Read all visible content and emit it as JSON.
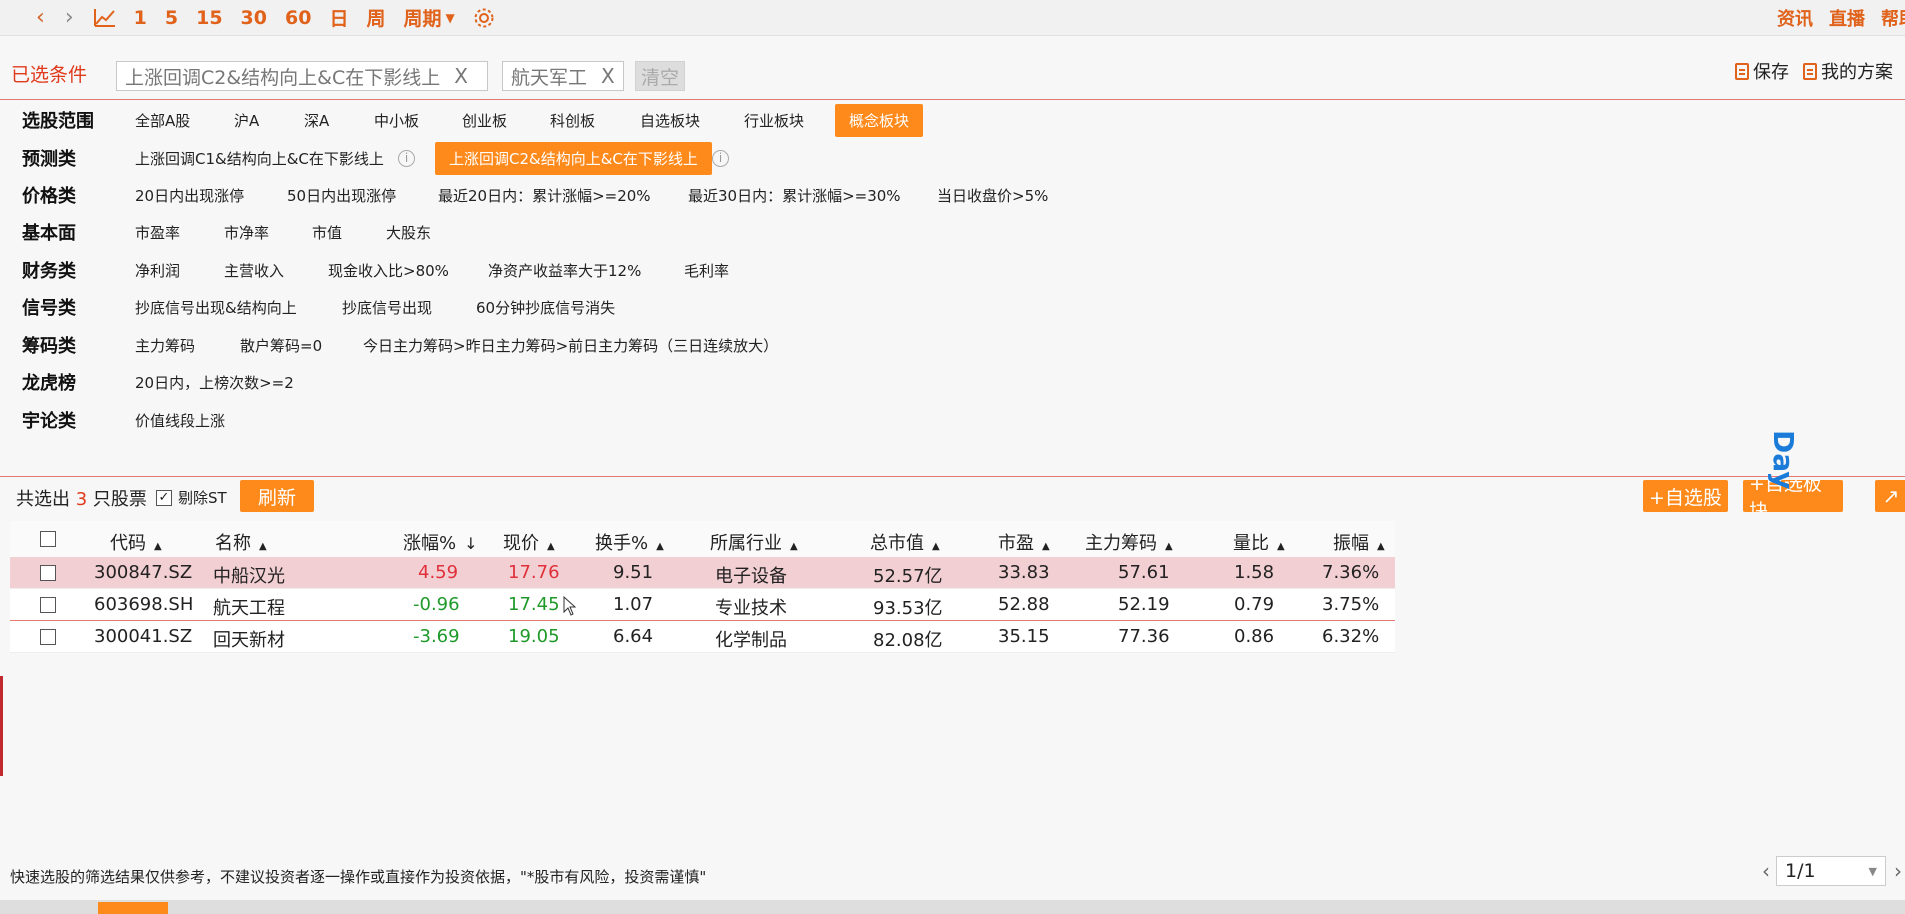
{
  "toolbar": {
    "periods": [
      "1",
      "5",
      "15",
      "30",
      "60",
      "日",
      "周"
    ],
    "period_menu": "周期",
    "right_links": [
      "资讯",
      "直播",
      "帮助"
    ]
  },
  "conditions": {
    "title": "已选条件",
    "chips": [
      "上涨回调C2&结构向上&C在下影线上",
      "航天军工"
    ],
    "clear_label": "清空",
    "save_label": "保存",
    "my_plan_label": "我的方案"
  },
  "filters": [
    {
      "label": "选股范围",
      "options": [
        "全部A股",
        "沪A",
        "深A",
        "中小板",
        "创业板",
        "科创板",
        "自选板块",
        "行业板块",
        "概念板块"
      ],
      "selected": "概念板块"
    },
    {
      "label": "预测类",
      "options": [
        "上涨回调C1&结构向上&C在下影线上",
        "上涨回调C2&结构向上&C在下影线上"
      ],
      "selected": "上涨回调C2&结构向上&C在下影线上"
    },
    {
      "label": "价格类",
      "options": [
        "20日内出现涨停",
        "50日内出现涨停",
        "最近20日内：累计涨幅>=20%",
        "最近30日内：累计涨幅>=30%",
        "当日收盘价>5%"
      ]
    },
    {
      "label": "基本面",
      "options": [
        "市盈率",
        "市净率",
        "市值",
        "大股东"
      ]
    },
    {
      "label": "财务类",
      "options": [
        "净利润",
        "主营收入",
        "现金收入比>80%",
        "净资产收益率大于12%",
        "毛利率"
      ]
    },
    {
      "label": "信号类",
      "options": [
        "抄底信号出现&结构向上",
        "抄底信号出现",
        "60分钟抄底信号消失"
      ]
    },
    {
      "label": "筹码类",
      "options": [
        "主力筹码",
        "散户筹码=0",
        "今日主力筹码>昨日主力筹码>前日主力筹码（三日连续放大）"
      ]
    },
    {
      "label": "龙虎榜",
      "options": [
        "20日内，上榜次数>=2"
      ]
    },
    {
      "label": "宇论类",
      "options": [
        "价值线段上涨"
      ]
    }
  ],
  "results": {
    "prefix": "共选出",
    "count": "3",
    "suffix": "只股票",
    "remove_st_label": "剔除ST",
    "refresh_label": "刷新",
    "add_stock_label": "+自选股",
    "add_block_label": "+自选板块",
    "day_label": "Day"
  },
  "table": {
    "headers": [
      "代码",
      "名称",
      "涨幅%",
      "现价",
      "换手%",
      "所属行业",
      "总市值",
      "市盈",
      "主力筹码",
      "量比",
      "振幅"
    ],
    "rows": [
      {
        "code": "300847.SZ",
        "name": "中船汉光",
        "change": "4.59",
        "price": "17.76",
        "turnover": "9.51",
        "industry": "电子设备",
        "mktcap": "52.57亿",
        "pe": "33.83",
        "main_chip": "57.61",
        "vol_ratio": "1.58",
        "amplitude": "7.36%",
        "dir": "up"
      },
      {
        "code": "603698.SH",
        "name": "航天工程",
        "change": "-0.96",
        "price": "17.45",
        "turnover": "1.07",
        "industry": "专业技术",
        "mktcap": "93.53亿",
        "pe": "52.88",
        "main_chip": "52.19",
        "vol_ratio": "0.79",
        "amplitude": "3.75%",
        "dir": "down"
      },
      {
        "code": "300041.SZ",
        "name": "回天新材",
        "change": "-3.69",
        "price": "19.05",
        "turnover": "6.64",
        "industry": "化学制品",
        "mktcap": "82.08亿",
        "pe": "35.15",
        "main_chip": "77.36",
        "vol_ratio": "0.86",
        "amplitude": "6.32%",
        "dir": "down"
      }
    ]
  },
  "footer": {
    "disclaimer": "快速选股的筛选结果仅供参考，不建议投资者逐一操作或直接作为投资依据，\"*股市有风险，投资需谨慎\"",
    "page": "1/1"
  }
}
